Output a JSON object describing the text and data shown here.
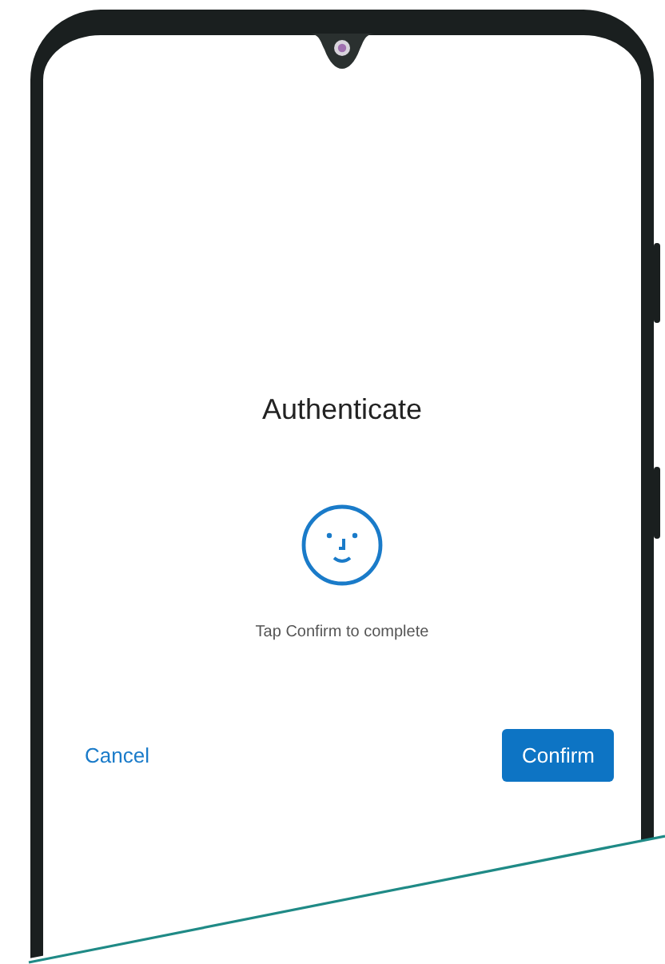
{
  "dialog": {
    "title": "Authenticate",
    "message": "Tap Confirm to complete",
    "buttons": [
      {
        "label": "Cancel",
        "kind": "text"
      },
      {
        "label": "Confirm",
        "kind": "filled"
      }
    ]
  }
}
